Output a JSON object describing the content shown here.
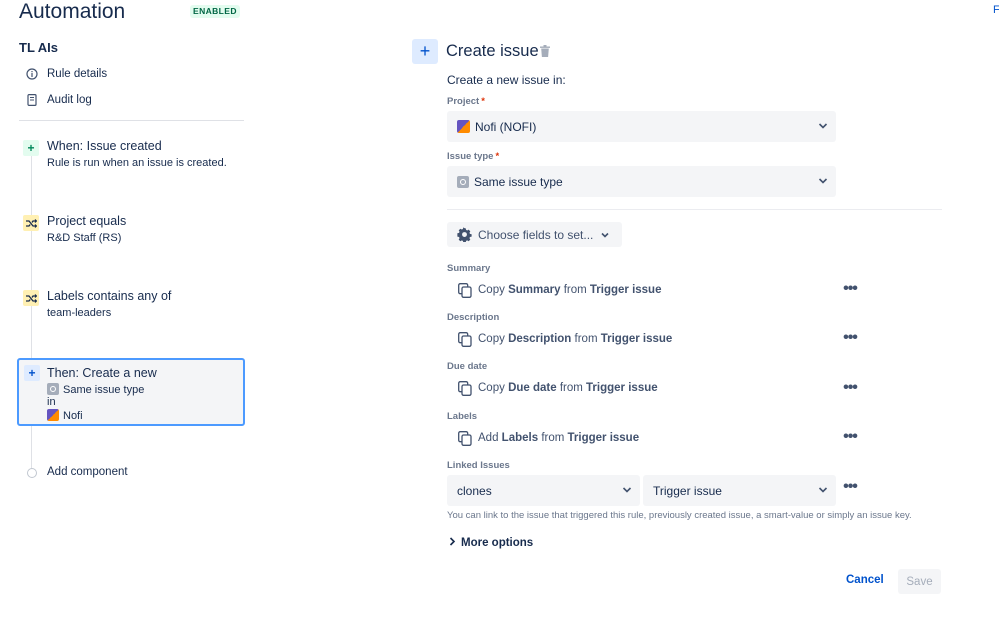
{
  "header": {
    "app_title": "Automation",
    "status_badge": "ENABLED",
    "corner_link": "F"
  },
  "sidebar": {
    "rule_name": "TL AIs",
    "nav": [
      {
        "label": "Rule details",
        "icon": "info-icon"
      },
      {
        "label": "Audit log",
        "icon": "document-icon"
      }
    ],
    "steps": [
      {
        "title": "When: Issue created",
        "sub": "Rule is run when an issue is created.",
        "icon": "plus-icon"
      },
      {
        "title": "Project equals",
        "sub": "R&D Staff (RS)",
        "icon": "shuffle-icon"
      },
      {
        "title": "Labels contains any of",
        "sub": "team-leaders",
        "icon": "shuffle-icon"
      },
      {
        "title": "Then: Create a new",
        "issue_type": "Same issue type",
        "in": "in",
        "project": "Nofi",
        "icon": "plus-icon"
      }
    ],
    "add_component": "Add component"
  },
  "panel": {
    "title": "Create issue",
    "intro": "Create a new issue in:",
    "project_label": "Project",
    "project_value": "Nofi (NOFI)",
    "issue_type_label": "Issue type",
    "issue_type_value": "Same issue type",
    "required_mark": "*",
    "choose_fields": "Choose fields to set...",
    "fields": [
      {
        "label": "Summary",
        "verb": "Copy",
        "field": "Summary",
        "from": "from",
        "source": "Trigger issue"
      },
      {
        "label": "Description",
        "verb": "Copy",
        "field": "Description",
        "from": "from",
        "source": "Trigger issue"
      },
      {
        "label": "Due date",
        "verb": "Copy",
        "field": "Due date",
        "from": "from",
        "source": "Trigger issue"
      },
      {
        "label": "Labels",
        "verb": "Add",
        "field": "Labels",
        "from": "from",
        "source": "Trigger issue"
      }
    ],
    "linked_issues_label": "Linked Issues",
    "link_type": "clones",
    "link_target": "Trigger issue",
    "helper": "You can link to the issue that triggered this rule, previously created issue, a smart-value or simply an issue key.",
    "more_options": "More options",
    "cancel": "Cancel",
    "save": "Save"
  },
  "colors": {
    "accent": "#0052cc",
    "selected_border": "#4c9aff",
    "enabled_text": "#006644",
    "required": "#de350b"
  }
}
